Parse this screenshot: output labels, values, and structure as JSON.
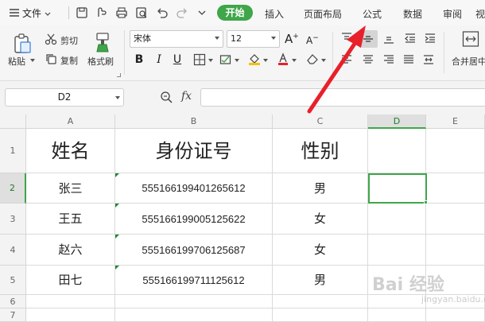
{
  "menu": {
    "file": "文件",
    "tabs": {
      "start": "开始",
      "insert": "插入",
      "layout": "页面布局",
      "formula": "公式",
      "data": "数据",
      "review": "审阅",
      "view": "视"
    }
  },
  "ribbon": {
    "paste": "粘贴",
    "cut": "剪切",
    "copy": "复制",
    "format_painter": "格式刷",
    "font_name": "宋体",
    "font_size": "12",
    "bold": "B",
    "italic": "I",
    "underline": "U",
    "merge_center": "合并居中"
  },
  "formula_bar": {
    "name_box": "D2",
    "fx": "fx"
  },
  "sheet": {
    "columns": [
      "A",
      "B",
      "C",
      "D",
      "E"
    ],
    "rows": [
      "1",
      "2",
      "3",
      "4",
      "5",
      "6",
      "7"
    ],
    "header": {
      "name": "姓名",
      "id": "身份证号",
      "gender": "性别"
    },
    "records": [
      {
        "name": "张三",
        "id": "555166199401265612",
        "gender": "男"
      },
      {
        "name": "王五",
        "id": "555166199005125622",
        "gender": "女"
      },
      {
        "name": "赵六",
        "id": "555166199706125687",
        "gender": "女"
      },
      {
        "name": "田七",
        "id": "555166199711125612",
        "gender": "男"
      }
    ]
  },
  "watermark": {
    "brand": "Bai 经验",
    "sub": "jingyan.baidu.com"
  },
  "colors": {
    "accent": "#3fa64a",
    "arrow": "#e8202a"
  }
}
